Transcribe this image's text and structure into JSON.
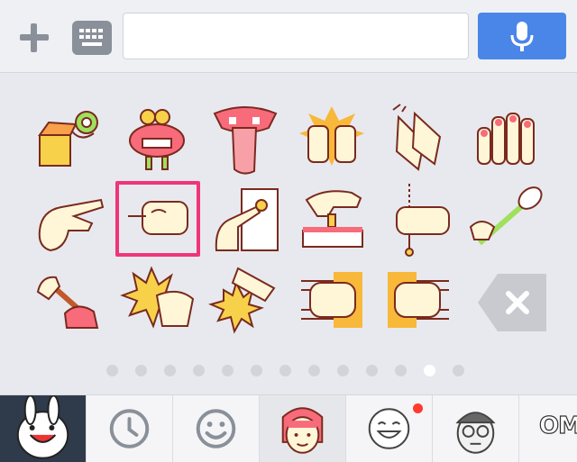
{
  "toolbar": {
    "add_icon": "plus-icon",
    "keyboard_icon": "keyboard-icon",
    "text_input_value": "",
    "mic_icon": "microphone-icon",
    "mic_color": "#4a86e8"
  },
  "stickers": {
    "row1": [
      "jack-in-the-box-sticker",
      "wind-up-monster-sticker",
      "tongue-mouth-sticker",
      "hands-praising-sticker",
      "clapping-hands-sticker",
      "painted-nails-sticker"
    ],
    "row2": [
      "pointing-hand-sticker",
      "fist-poke-sticker",
      "finger-press-button-sticker",
      "hand-pull-lever-sticker",
      "fist-pull-chain-sticker",
      "toilet-brush-sticker"
    ],
    "row3": [
      "plunger-sticker",
      "slap-face-sticker",
      "slap-hand-sticker",
      "punch-left-sticker",
      "punch-right-sticker"
    ],
    "selected_index": 7,
    "selection_color": "#f0347a"
  },
  "delete_icon": "backspace-icon",
  "pager": {
    "count": 13,
    "active": 11
  },
  "tabs": {
    "items": [
      "brown-cony-pack",
      "recent-clock",
      "emoji-smile",
      "selected-girl-pack",
      "smiling-face-pack",
      "glasses-boy-pack",
      "omg-pack"
    ],
    "omg_label": "OMG",
    "badge_color": "#ff3b2f"
  }
}
